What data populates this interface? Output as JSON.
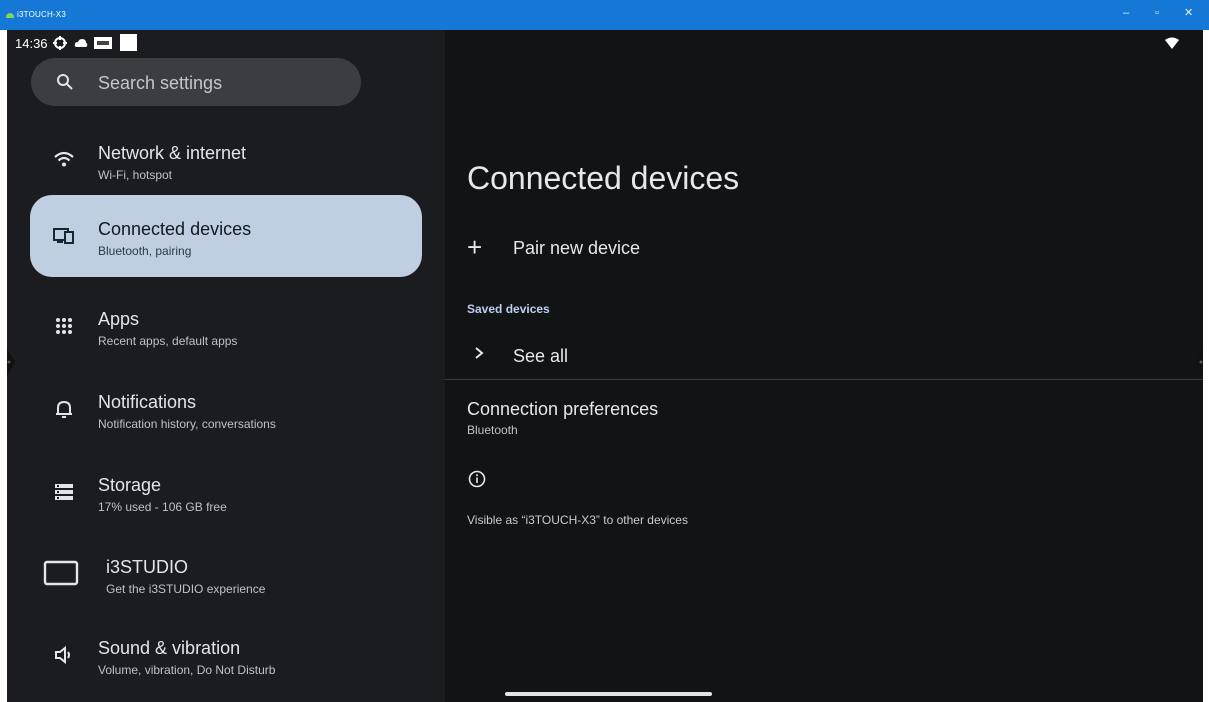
{
  "window": {
    "title": "i3TOUCH-X3"
  },
  "status_bar": {
    "time": "14:36"
  },
  "search": {
    "placeholder": "Search settings"
  },
  "settings_items": [
    {
      "title": "Network & internet",
      "subtitle": "Wi-Fi, hotspot",
      "icon": "wifi-icon"
    },
    {
      "title": "Connected devices",
      "subtitle": "Bluetooth, pairing",
      "icon": "devices-icon",
      "selected": true
    },
    {
      "title": "Apps",
      "subtitle": "Recent apps, default apps",
      "icon": "apps-grid-icon"
    },
    {
      "title": "Notifications",
      "subtitle": "Notification history, conversations",
      "icon": "bell-icon"
    },
    {
      "title": "Storage",
      "subtitle": "17% used - 106 GB free",
      "icon": "storage-icon"
    },
    {
      "title": "i3STUDIO",
      "subtitle": "Get the i3STUDIO experience",
      "icon": "screen-icon"
    },
    {
      "title": "Sound & vibration",
      "subtitle": "Volume, vibration, Do Not Disturb",
      "icon": "speaker-icon"
    }
  ],
  "detail": {
    "title": "Connected devices",
    "pair_new_device": "Pair new device",
    "saved_devices_header": "Saved devices",
    "see_all": "See all",
    "connection_preferences": {
      "title": "Connection preferences",
      "subtitle": "Bluetooth"
    },
    "visible_as": "Visible as “i3TOUCH-X3” to other devices"
  },
  "colors": {
    "titlebar": "#1577d6",
    "left_bg": "#1b1c1f",
    "right_bg": "#121315",
    "selected_item": "#bfcfe1",
    "section_header": "#bcd0ee"
  }
}
